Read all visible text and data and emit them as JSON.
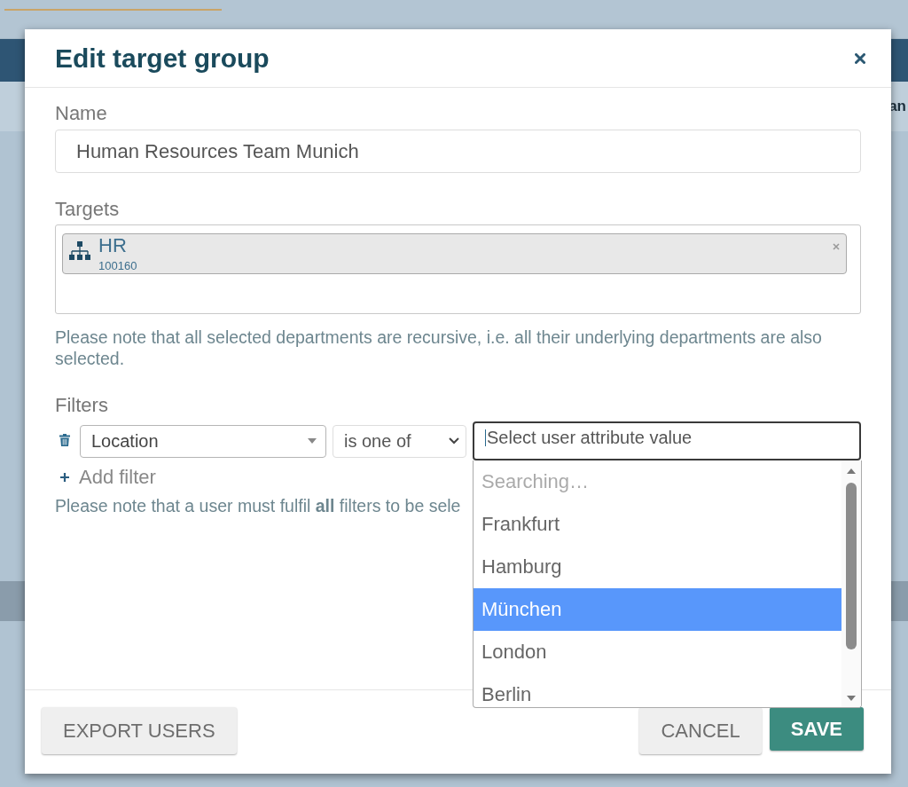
{
  "background": {
    "header_text": "an"
  },
  "dialog": {
    "title": "Edit target group"
  },
  "name": {
    "label": "Name",
    "value": "Human Resources Team Munich"
  },
  "targets": {
    "label": "Targets",
    "chips": [
      {
        "title": "HR",
        "code": "100160"
      }
    ],
    "note": "Please note that all selected departments are recursive, i.e. all their underlying departments are also selected."
  },
  "filters": {
    "label": "Filters",
    "rows": [
      {
        "attribute": "Location",
        "operator": "is one of",
        "values": {
          "placeholder": "Select user attribute value",
          "focused": true,
          "expanded": true,
          "status": "Searching…",
          "options": [
            {
              "label": "Frankfurt",
              "selected": false
            },
            {
              "label": "Hamburg",
              "selected": false
            },
            {
              "label": "München",
              "selected": true
            },
            {
              "label": "London",
              "selected": false
            },
            {
              "label": "Berlin",
              "selected": false
            }
          ]
        }
      }
    ],
    "add_label": "Add filter",
    "note": "Please note that a user must fulfil **all** filters to be sele"
  },
  "footer": {
    "left_buttons": [
      {
        "label": "EXPORT USERS",
        "kind": "secondary"
      }
    ],
    "right_buttons": [
      {
        "label": "CANCEL",
        "kind": "secondary"
      },
      {
        "label": "SAVE",
        "kind": "primary"
      }
    ]
  }
}
